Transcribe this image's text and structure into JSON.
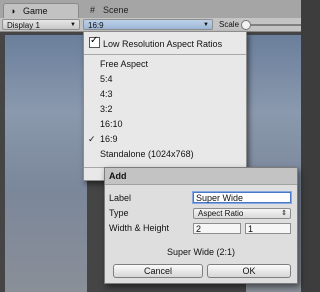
{
  "tabs": [
    {
      "label": "Game",
      "icon": "game-tab-icon"
    },
    {
      "label": "Scene",
      "icon": "scene-grid-icon"
    }
  ],
  "toolbar": {
    "display_select": "Display 1",
    "aspect_select": "16:9",
    "scale_label": "Scale"
  },
  "menu": {
    "low_res_label": "Low Resolution Aspect Ratios",
    "low_res_checked": true,
    "items": [
      {
        "label": "Free Aspect",
        "checked": false
      },
      {
        "label": "5:4",
        "checked": false
      },
      {
        "label": "4:3",
        "checked": false
      },
      {
        "label": "3:2",
        "checked": false
      },
      {
        "label": "16:10",
        "checked": false
      },
      {
        "label": "16:9",
        "checked": true
      },
      {
        "label": "Standalone (1024x768)",
        "checked": false
      }
    ]
  },
  "dialog": {
    "title": "Add",
    "label_text": "Label",
    "label_value": "Super Wide",
    "type_text": "Type",
    "type_value": "Aspect Ratio",
    "wh_text": "Width & Height",
    "width_value": "2",
    "height_value": "1",
    "summary": "Super Wide (2:1)",
    "cancel_label": "Cancel",
    "ok_label": "OK"
  }
}
